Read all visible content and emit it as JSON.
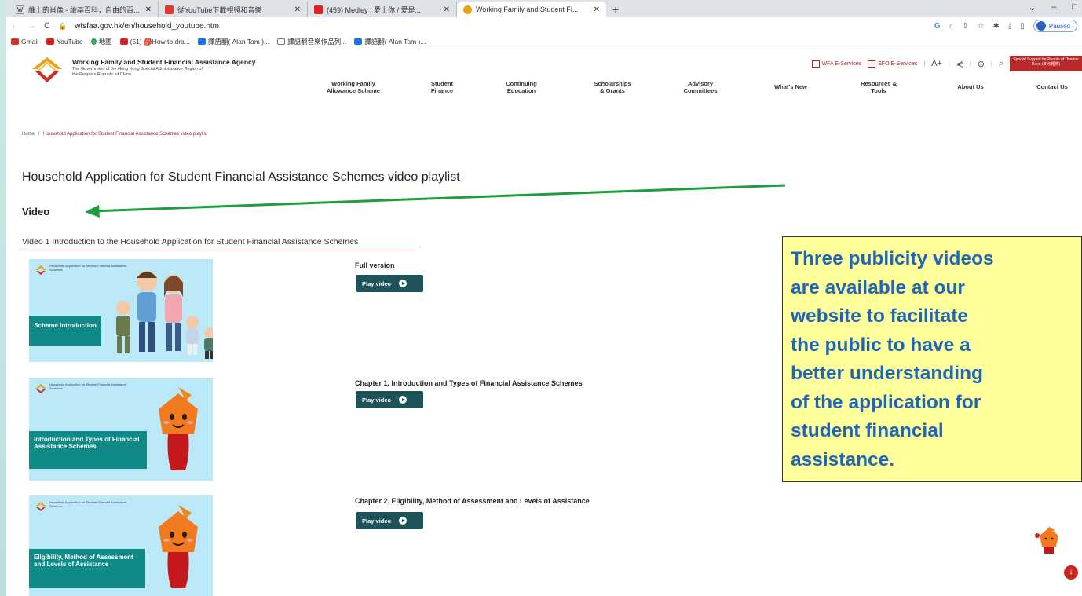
{
  "browser": {
    "tabs": [
      {
        "title": "維上的肖像 - 維基百科，自由的百...",
        "favicon_color": "#ffffff",
        "active": false
      },
      {
        "title": "從YouTube下載視頻和音樂",
        "favicon_color": "#e03b30",
        "active": false
      },
      {
        "title": "(459) Medley : 愛上你 / 愛是...",
        "favicon_color": "#e02020",
        "active": false
      },
      {
        "title": "Working Family and Student Fi...",
        "favicon_color": "#e8a21a",
        "active": true
      }
    ],
    "url": "wfsfaa.gov.hk/en/household_youtube.htm",
    "profile_status": "Paused",
    "bookmarks": [
      {
        "label": "Gmail",
        "color": "#d93025"
      },
      {
        "label": "YouTube",
        "color": "#e02020"
      },
      {
        "label": "地圖",
        "color": "#34a853"
      },
      {
        "label": "(51) 🎒How to dra...",
        "color": "#e02020"
      },
      {
        "label": "譯語翻( Alan Tam )...",
        "color": "#1a73e8"
      },
      {
        "label": "譯語翻音樂作品列...",
        "color": "#555555"
      },
      {
        "label": "譯語翻( Alan Tam )...",
        "color": "#1a73e8"
      }
    ]
  },
  "site": {
    "agency_name": "Working Family and Student Financial Assistance Agency",
    "agency_sub": "The Government of the Hong Kong Special Administrative Region of the People's Republic of China",
    "wfa_eservices": "WFA E-Services",
    "sfo_eservices": "SFO E-Services",
    "font_size_label": "A+",
    "special_support": "Special Support for People of Diverse Race (多元種族)",
    "nav": [
      {
        "label": "Working Family Allowance Scheme"
      },
      {
        "label": "Student Finance"
      },
      {
        "label": "Continuing Education"
      },
      {
        "label": "Scholarships & Grants"
      },
      {
        "label": "Advisory Committees"
      },
      {
        "label": "What's New"
      },
      {
        "label": "Resources & Tools"
      },
      {
        "label": "About Us"
      },
      {
        "label": "Contact Us"
      }
    ],
    "brand_color": "#b82a2a",
    "accent_teal": "#1e5359"
  },
  "breadcrumb": {
    "home": "Home",
    "separator": "/",
    "current": "Household Application for Student Financial Assistance Schemes video playlist"
  },
  "page_title": "Household Application for Student Financial Assistance Schemes video playlist",
  "section_title": "Video",
  "video1_label": "Video 1 Introduction to the Household Application for Student Financial Assistance Schemes",
  "videos": [
    {
      "chapter": "Full version",
      "play_label": "Play video",
      "thumb_label": "Scheme Introduction",
      "thumb_header": "Household Application for Student Financial Assistance Schemes"
    },
    {
      "chapter": "Chapter 1. Introduction and Types of Financial Assistance Schemes",
      "play_label": "Play video",
      "thumb_label": "Introduction and Types of Financial Assistance Schemes",
      "thumb_header": "Household Application for Student Financial Assistance Schemes"
    },
    {
      "chapter": "Chapter 2. Eligibility, Method of Assessment and Levels of Assistance",
      "play_label": "Play video",
      "thumb_label": "Eligibility, Method of Assessment and Levels of Assistance",
      "thumb_header": "Household Application for Student Financial Assistance Schemes"
    }
  ],
  "callout": {
    "lines": [
      "Three publicity videos",
      "are available at our",
      "website to facilitate",
      "the public to have a",
      "better understanding",
      "of the application for",
      "student financial",
      "assistance."
    ]
  }
}
